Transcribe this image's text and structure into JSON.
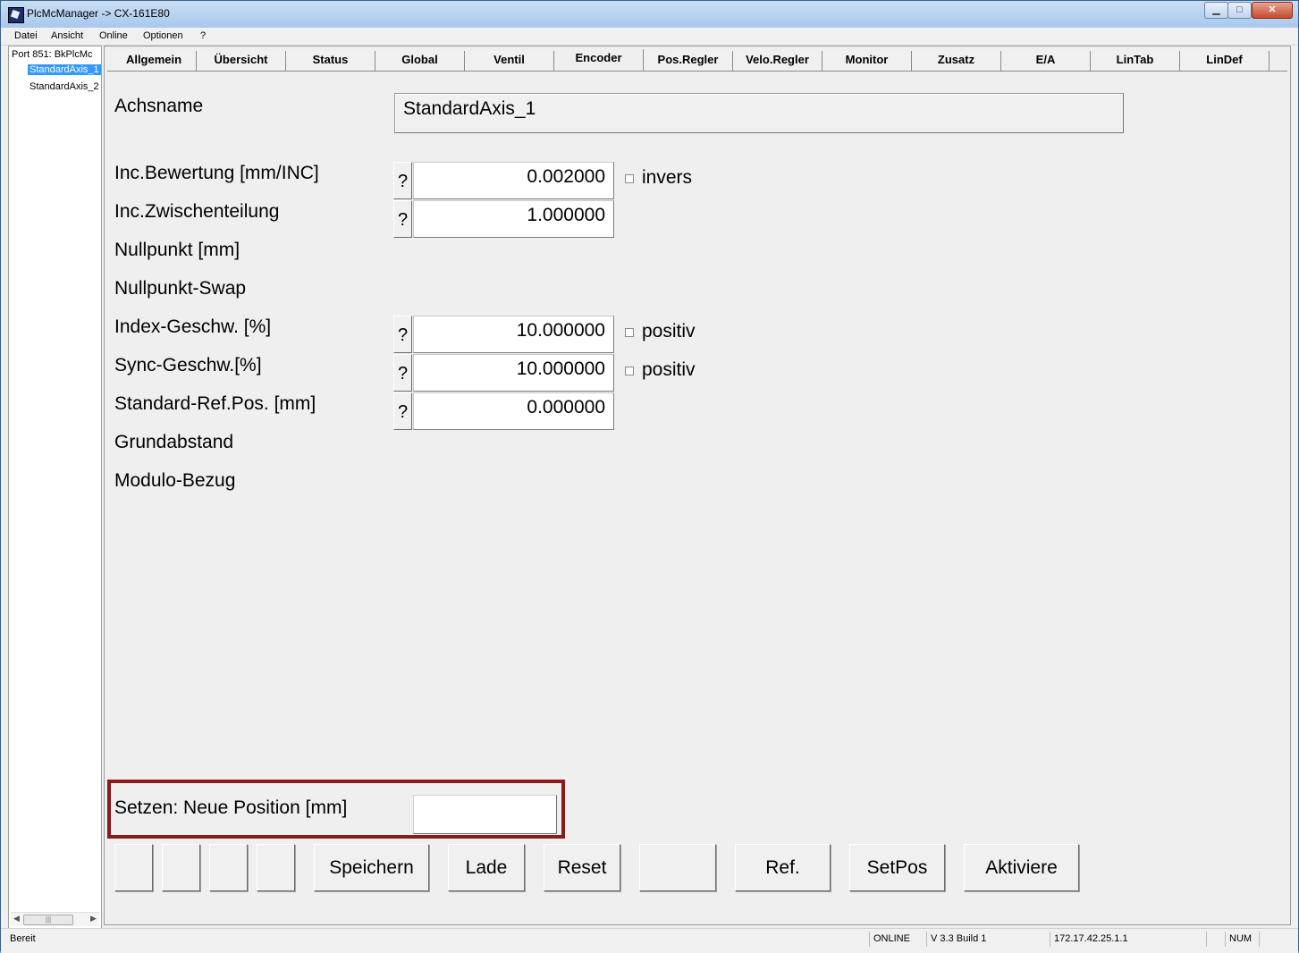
{
  "window": {
    "title": "PlcMcManager -> CX-161E80"
  },
  "menu": [
    "Datei",
    "Ansicht",
    "Online",
    "Optionen",
    "?"
  ],
  "tree": {
    "root": "Port 851: BkPlcMc",
    "items": [
      {
        "label": "StandardAxis_1",
        "selected": true
      },
      {
        "label": "StandardAxis_2",
        "selected": false
      }
    ]
  },
  "tabs": [
    {
      "label": "Allgemein"
    },
    {
      "label": "Übersicht"
    },
    {
      "label": "Status"
    },
    {
      "label": "Global"
    },
    {
      "label": "Ventil"
    },
    {
      "label": "Encoder",
      "active": true
    },
    {
      "label": "Pos.Regler"
    },
    {
      "label": "Velo.Regler"
    },
    {
      "label": "Monitor"
    },
    {
      "label": "Zusatz"
    },
    {
      "label": "E/A"
    },
    {
      "label": "LinTab"
    },
    {
      "label": "LinDef"
    }
  ],
  "form": {
    "achsname_label": "Achsname",
    "achsname_value": "StandardAxis_1",
    "rows": [
      {
        "label": "Inc.Bewertung [mm/INC]",
        "value": "0.002000",
        "help": "?",
        "checkbox_label": "invers"
      },
      {
        "label": "Inc.Zwischenteilung",
        "value": "1.000000",
        "help": "?"
      },
      {
        "label": "Nullpunkt [mm]"
      },
      {
        "label": "Nullpunkt-Swap"
      },
      {
        "label": "Index-Geschw. [%]",
        "value": "10.000000",
        "help": "?",
        "checkbox_label": "positiv"
      },
      {
        "label": "Sync-Geschw.[%]",
        "value": "10.000000",
        "help": "?",
        "checkbox_label": "positiv"
      },
      {
        "label": "Standard-Ref.Pos. [mm]",
        "value": "0.000000",
        "help": "?"
      },
      {
        "label": "Grundabstand"
      },
      {
        "label": "Modulo-Bezug"
      }
    ],
    "neue_position_label": "Setzen: Neue Position [mm]",
    "neue_position_value": ""
  },
  "buttons": {
    "speichern": "Speichern",
    "lade": "Lade",
    "reset": "Reset",
    "ref": "Ref.",
    "setpos": "SetPos",
    "aktiviere": "Aktiviere"
  },
  "status": {
    "text": "Bereit",
    "online": "ONLINE",
    "version": "V 3.3 Build 1",
    "address": "172.17.42.25.1.1",
    "num": "NUM"
  },
  "colors": {
    "highlight_border": "#8b1a1a",
    "selection": "#3399ff"
  }
}
